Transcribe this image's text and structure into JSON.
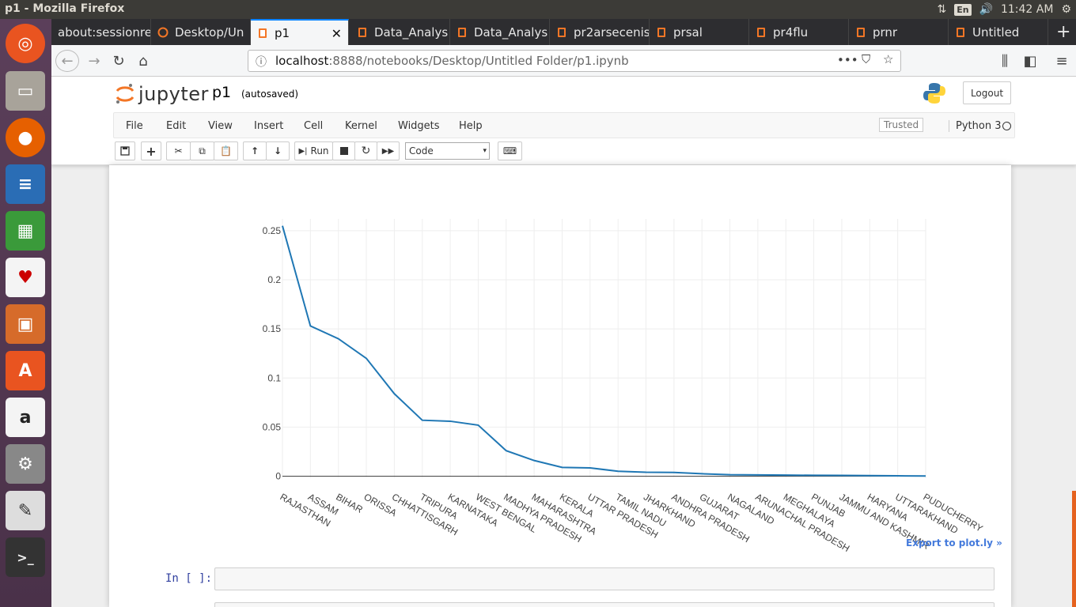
{
  "system": {
    "window_title": "p1 - Mozilla Firefox",
    "keyboard_layout": "En",
    "clock": "11:42 AM"
  },
  "tabs": [
    {
      "label": "about:sessionre",
      "active": false
    },
    {
      "label": "Desktop/Un",
      "active": false
    },
    {
      "label": "p1",
      "active": true
    },
    {
      "label": "Data_Analys",
      "active": false
    },
    {
      "label": "Data_Analys",
      "active": false
    },
    {
      "label": "pr2arsecenis",
      "active": false
    },
    {
      "label": "prsal",
      "active": false
    },
    {
      "label": "pr4flu",
      "active": false
    },
    {
      "label": "prnr",
      "active": false
    },
    {
      "label": "Untitled",
      "active": false
    }
  ],
  "browser": {
    "url_host": "localhost",
    "url_path": ":8888/notebooks/Desktop/Untitled Folder/p1.ipynb",
    "new_tab": "+",
    "more": "•••"
  },
  "jupyter": {
    "logo_text": "jupyter",
    "notebook_name": "p1",
    "autosave_status": "(autosaved)",
    "logout_label": "Logout",
    "menu": [
      "File",
      "Edit",
      "View",
      "Insert",
      "Cell",
      "Kernel",
      "Widgets",
      "Help"
    ],
    "trusted_label": "Trusted",
    "kernel_name": "Python 3",
    "run_label": "Run",
    "cell_type": "Code",
    "export_link": "Export to plot.ly »",
    "prompt": "In [ ]:"
  },
  "chart_data": {
    "type": "line",
    "categories": [
      "RAJASTHAN",
      "ASSAM",
      "BIHAR",
      "ORISSA",
      "CHHATTISGARH",
      "TRIPURA",
      "KARNATAKA",
      "WEST BENGAL",
      "MADHYA PRADESH",
      "MAHARASHTRA",
      "KERALA",
      "UTTAR PRADESH",
      "TAMIL NADU",
      "JHARKHAND",
      "ANDHRA PRADESH",
      "GUJARAT",
      "NAGALAND",
      "ARUNACHAL PRADESH",
      "MEGHALAYA",
      "PUNJAB",
      "JAMMU AND KASHMIR",
      "HARYANA",
      "UTTARAKHAND",
      "PUDUCHERRY"
    ],
    "values": [
      0.255,
      0.153,
      0.14,
      0.12,
      0.084,
      0.057,
      0.056,
      0.052,
      0.026,
      0.016,
      0.009,
      0.0085,
      0.005,
      0.004,
      0.0038,
      0.0025,
      0.0015,
      0.0013,
      0.0011,
      0.0009,
      0.0008,
      0.0006,
      0.0004,
      0.0002
    ],
    "yticks": [
      0,
      0.05,
      0.1,
      0.15,
      0.2,
      0.25
    ],
    "ytick_labels": [
      "0",
      "0.05",
      "0.1",
      "0.15",
      "0.2",
      "0.25"
    ],
    "ylim": [
      -0.002,
      0.262
    ],
    "grid": true,
    "line_color": "#1f77b4"
  }
}
